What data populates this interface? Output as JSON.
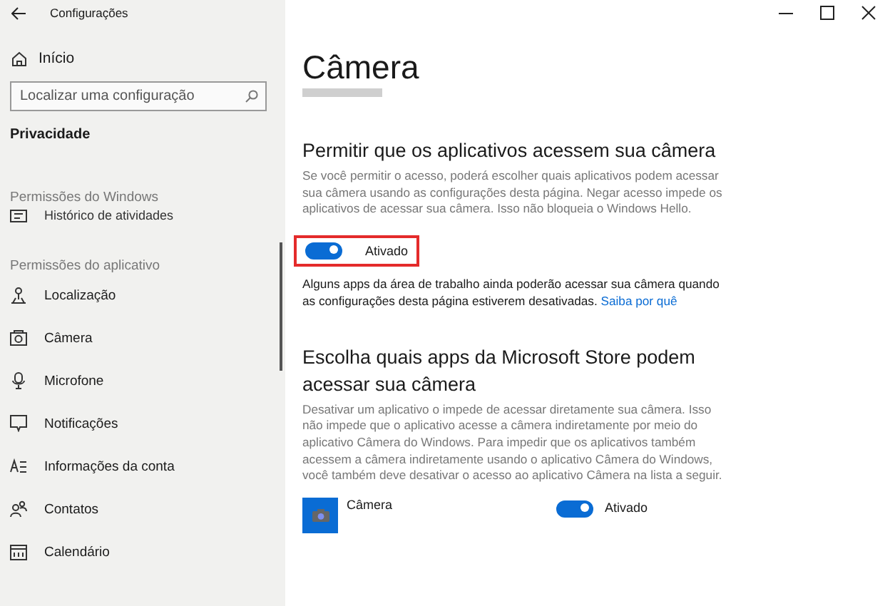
{
  "window": {
    "title": "Configurações"
  },
  "sidebar": {
    "home": "Início",
    "search": {
      "placeholder": "Localizar uma configuração"
    },
    "section": "Privacidade",
    "groups": [
      {
        "heading": "Permissões do Windows",
        "items": [
          {
            "label": "Histórico de atividades",
            "selected": false
          }
        ]
      },
      {
        "heading": "Permissões do aplicativo",
        "items": [
          {
            "label": "Localização",
            "selected": false
          },
          {
            "label": "Câmera",
            "selected": false
          },
          {
            "label": "Microfone",
            "selected": false
          },
          {
            "label": "Notificações",
            "selected": false
          },
          {
            "label": "Informações da conta",
            "selected": false
          },
          {
            "label": "Contatos",
            "selected": false
          },
          {
            "label": "Calendário",
            "selected": false
          }
        ]
      }
    ]
  },
  "page": {
    "title": "Câmera",
    "sections": [
      {
        "heading": "Permitir que os aplicativos acessem sua câmera",
        "description": "Se você permitir o acesso, poderá escolher quais aplicativos podem acessar sua câmera usando as configurações desta página. Negar acesso impede os aplicativos de acessar sua câmera. Isso não bloqueia o Windows Hello.",
        "toggle": {
          "on": true,
          "label": "Ativado",
          "highlighted": true
        },
        "note": "Alguns apps da área de trabalho ainda poderão acessar sua câmera quando as configurações desta página estiverem desativadas.",
        "link": "Saiba por quê"
      },
      {
        "heading": "Escolha quais apps da Microsoft Store podem acessar sua câmera",
        "description": "Desativar um aplicativo o impede de acessar diretamente sua câmera. Isso não impede que o aplicativo acesse a câmera indiretamente por meio do aplicativo Câmera do Windows. Para impedir que os aplicativos também acessem a câmera indiretamente usando o aplicativo Câmera do Windows, você também deve desativar o acesso ao aplicativo Câmera na lista a seguir.",
        "apps": [
          {
            "name": "Câmera",
            "on": true,
            "label": "Ativado"
          }
        ]
      }
    ]
  }
}
